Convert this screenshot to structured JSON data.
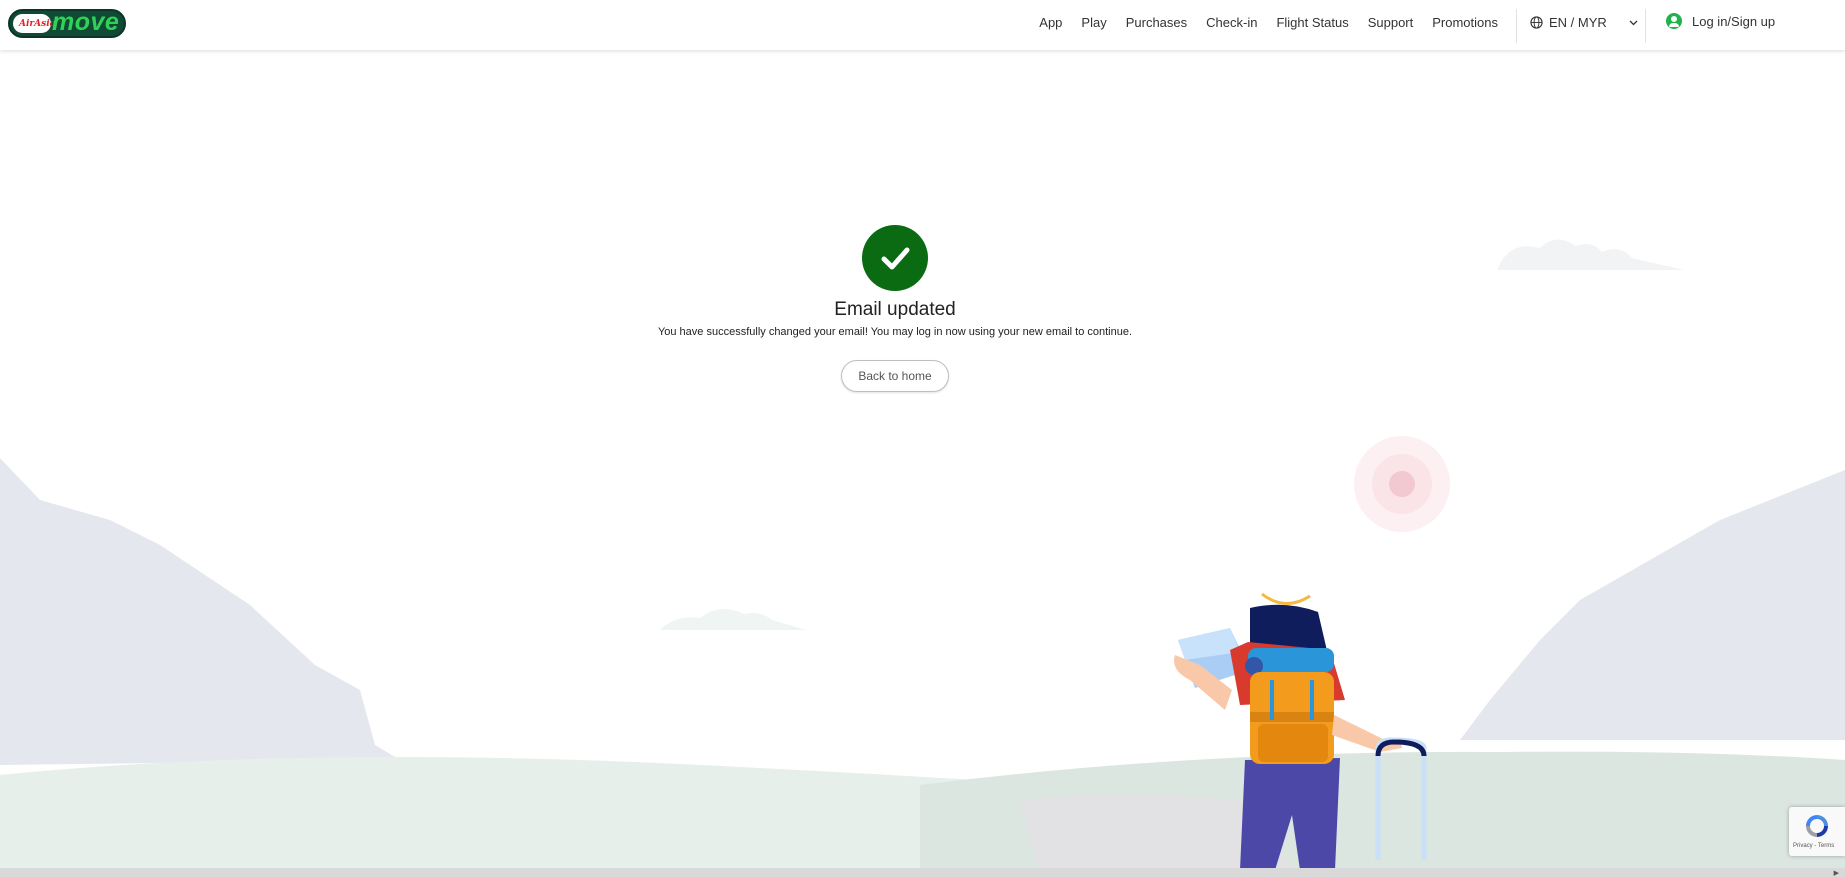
{
  "header": {
    "logo_small": "AirAsia",
    "logo_text": "move",
    "nav": [
      "App",
      "Play",
      "Purchases",
      "Check-in",
      "Flight Status",
      "Support",
      "Promotions"
    ],
    "language": "EN / MYR",
    "login_label": "Log in/Sign up"
  },
  "main": {
    "title": "Email updated",
    "message": "You have successfully changed your email! You may log in now using your new email to continue.",
    "back_button": "Back to home"
  },
  "recaptcha": {
    "terms": "Privacy - Terms"
  },
  "colors": {
    "success_green": "#0a6b12",
    "brand_green": "#31d158",
    "brand_dark": "#0f4a35"
  }
}
